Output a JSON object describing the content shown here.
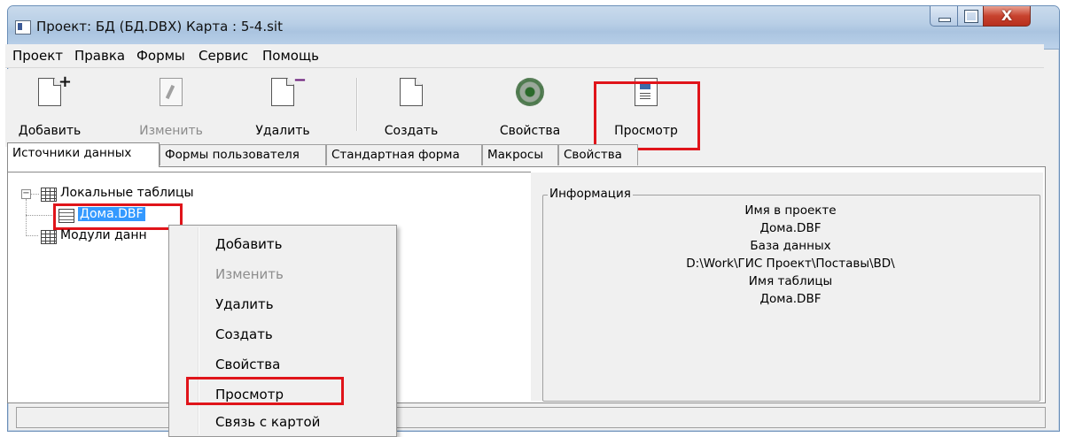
{
  "window": {
    "title": "Проект: БД (БД.DBX)  Карта : 5-4.sit",
    "close_glyph": "X"
  },
  "menu": [
    "Проект",
    "Правка",
    "Формы",
    "Сервис",
    "Помощь"
  ],
  "toolbar": {
    "add": "Добавить",
    "edit": "Изменить",
    "delete": "Удалить",
    "create": "Создать",
    "properties": "Свойства",
    "view": "Просмотр"
  },
  "tabs": [
    "Источники данных",
    "Формы пользователя",
    "Стандартная форма",
    "Макросы",
    "Свойства"
  ],
  "tree": {
    "toggle": "−",
    "local_tables": "Локальные таблицы",
    "selected_table": "Дома.DBF",
    "modules": "Модули данн"
  },
  "info": {
    "legend": "Информация",
    "lines": [
      "Имя в проекте",
      "Дома.DBF",
      "База данных",
      "D:\\Work\\ГИС Проект\\Поставы\\BD\\",
      "Имя таблицы",
      "Дома.DBF"
    ]
  },
  "context_menu": [
    "Добавить",
    "Изменить",
    "Удалить",
    "Создать",
    "Свойства",
    "Просмотр",
    "Связь с картой"
  ],
  "colors": {
    "highlight": "#e0141a",
    "selection": "#3399ff"
  },
  "icons": [
    "window-icon",
    "add-doc-icon",
    "edit-doc-icon",
    "delete-doc-icon",
    "new-doc-icon",
    "gear-icon",
    "view-doc-icon",
    "table-icon"
  ]
}
